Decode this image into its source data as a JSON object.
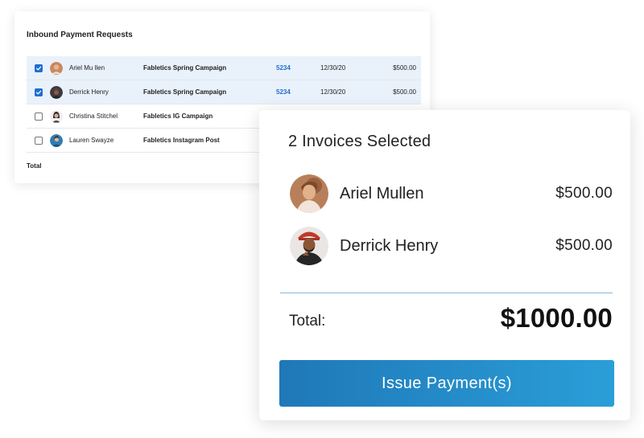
{
  "table": {
    "title": "Inbound Payment Requests",
    "rows": [
      {
        "name": "Ariel Mu llen",
        "campaign": "Fabletics Spring Campaign",
        "invoice": "5234",
        "date": "12/30/20",
        "amount": "$500.00",
        "checked": true
      },
      {
        "name": "Derrick Henry",
        "campaign": "Fabletics Spring Campaign",
        "invoice": "5234",
        "date": "12/30/20",
        "amount": "$500.00",
        "checked": true
      },
      {
        "name": "Christina Stitchel",
        "campaign": "Fabletics IG Campaign",
        "invoice": "",
        "date": "",
        "amount": "",
        "checked": false
      },
      {
        "name": "Lauren Swayze",
        "campaign": "Fabletics Instagram Post",
        "invoice": "",
        "date": "",
        "amount": "",
        "checked": false
      }
    ],
    "total_label": "Total"
  },
  "summary": {
    "title": "2 Invoices Selected",
    "items": [
      {
        "name": "Ariel Mullen",
        "amount": "$500.00"
      },
      {
        "name": "Derrick Henry",
        "amount": "$500.00"
      }
    ],
    "total_label": "Total:",
    "total_value": "$1000.00",
    "button_label": "Issue Payment(s)"
  },
  "colors": {
    "accent": "#1f6fd0",
    "button_start": "#1f78b8",
    "button_end": "#2a9ed8",
    "selected_row": "#e9f1fb"
  },
  "icons": {
    "checkbox": "checkmark-icon",
    "avatar": "avatar-photo"
  }
}
